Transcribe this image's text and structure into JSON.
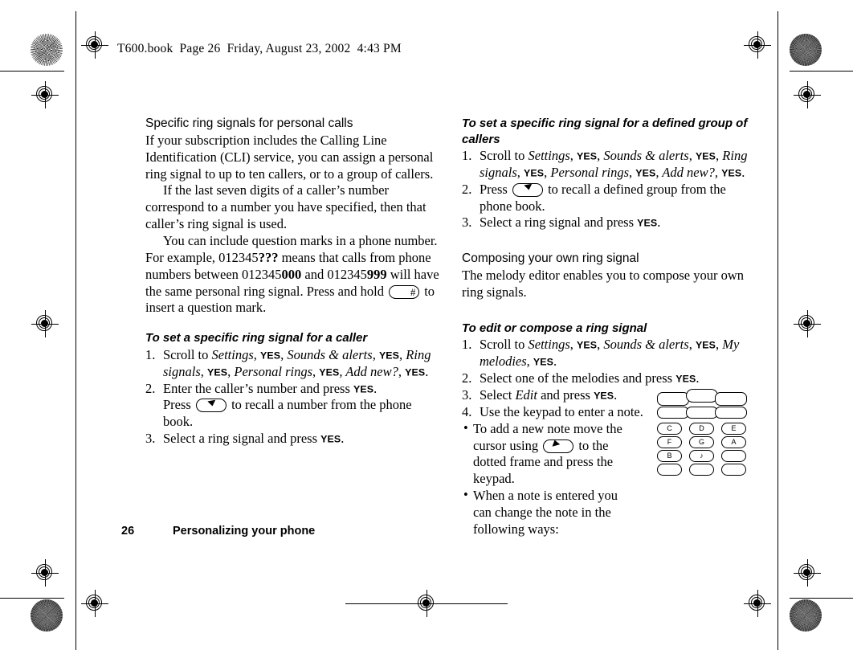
{
  "header": {
    "text": "T600.book  Page 26  Friday, August 23, 2002  4:43 PM"
  },
  "footer": {
    "page_number": "26",
    "section_title": "Personalizing your phone"
  },
  "keys": {
    "hash_label": "#",
    "yes_label": "YES",
    "down_key_name": "down-arrow-key",
    "up_key_name": "up-arrow-key"
  },
  "left_column": {
    "heading": "Specific ring signals for personal calls",
    "paragraph_1": "If your subscription includes the Calling Line Identification (CLI) service, you can assign a personal ring signal to up to ten callers, or to a group of callers.",
    "paragraph_2": "If the last seven digits of a caller’s number correspond to a number you have specified, then that caller’s ring signal is used.",
    "paragraph_3_a": "You can include question marks in a phone number. For example, 012345",
    "paragraph_3_b": "???",
    "paragraph_3_c": " means that calls from phone numbers between 012345",
    "paragraph_3_d": "000",
    "paragraph_3_e": " and 012345",
    "paragraph_3_f": "999",
    "paragraph_3_g": " will have the same personal ring signal. Press and hold ",
    "paragraph_3_h": " to insert a question mark.",
    "subheading": "To set a specific ring signal for a caller",
    "steps": [
      {
        "num": "1.",
        "parts": [
          {
            "t": "Scroll to ",
            "s": "plain"
          },
          {
            "t": "Settings",
            "s": "italic"
          },
          {
            "t": ", ",
            "s": "plain"
          },
          {
            "t": "YES",
            "s": "yes"
          },
          {
            "t": ", ",
            "s": "plain"
          },
          {
            "t": "Sounds & alerts",
            "s": "italic"
          },
          {
            "t": ", ",
            "s": "plain"
          },
          {
            "t": "YES",
            "s": "yes"
          },
          {
            "t": ", ",
            "s": "plain"
          },
          {
            "t": "Ring signals",
            "s": "italic"
          },
          {
            "t": ", ",
            "s": "plain"
          },
          {
            "t": "YES",
            "s": "yes"
          },
          {
            "t": ",  ",
            "s": "plain"
          },
          {
            "t": "Personal rings",
            "s": "italic"
          },
          {
            "t": ", ",
            "s": "plain"
          },
          {
            "t": "YES",
            "s": "yes"
          },
          {
            "t": ", ",
            "s": "italic"
          },
          {
            "t": "Add new?,",
            "s": "italic"
          },
          {
            "t": " ",
            "s": "plain"
          },
          {
            "t": "YES",
            "s": "yes"
          },
          {
            "t": ".",
            "s": "plain"
          }
        ]
      },
      {
        "num": "2.",
        "parts": [
          {
            "t": "Enter the caller’s number and press ",
            "s": "plain"
          },
          {
            "t": "YES",
            "s": "yes"
          },
          {
            "t": ".",
            "s": "plain"
          },
          {
            "t": "BREAK",
            "s": "break"
          },
          {
            "t": "Press ",
            "s": "plain"
          },
          {
            "t": "",
            "s": "key-down"
          },
          {
            "t": " to recall a number from the phone book.",
            "s": "plain"
          }
        ]
      },
      {
        "num": "3.",
        "parts": [
          {
            "t": "Select a ring signal and press ",
            "s": "plain"
          },
          {
            "t": "YES",
            "s": "yes"
          },
          {
            "t": ".",
            "s": "plain"
          }
        ]
      }
    ]
  },
  "right_column": {
    "subheading_1": "To set a specific ring signal for a defined group of callers",
    "steps_1": [
      {
        "num": "1.",
        "parts": [
          {
            "t": "Scroll to ",
            "s": "plain"
          },
          {
            "t": "Settings",
            "s": "italic"
          },
          {
            "t": ", ",
            "s": "plain"
          },
          {
            "t": "YES",
            "s": "yes"
          },
          {
            "t": ", ",
            "s": "plain"
          },
          {
            "t": "Sounds & alerts",
            "s": "italic"
          },
          {
            "t": ", ",
            "s": "plain"
          },
          {
            "t": "YES",
            "s": "yes"
          },
          {
            "t": ", ",
            "s": "plain"
          },
          {
            "t": "Ring signals",
            "s": "italic"
          },
          {
            "t": ", ",
            "s": "plain"
          },
          {
            "t": "YES",
            "s": "yes"
          },
          {
            "t": ",  ",
            "s": "plain"
          },
          {
            "t": "Personal rings",
            "s": "italic"
          },
          {
            "t": ", ",
            "s": "plain"
          },
          {
            "t": "YES",
            "s": "yes"
          },
          {
            "t": ", ",
            "s": "italic"
          },
          {
            "t": "Add new?,",
            "s": "italic"
          },
          {
            "t": " ",
            "s": "plain"
          },
          {
            "t": "YES",
            "s": "yes"
          },
          {
            "t": ".",
            "s": "plain"
          }
        ]
      },
      {
        "num": "2.",
        "parts": [
          {
            "t": "Press ",
            "s": "plain"
          },
          {
            "t": "",
            "s": "key-down"
          },
          {
            "t": " to recall a defined group from the phone book.",
            "s": "plain"
          }
        ]
      },
      {
        "num": "3.",
        "parts": [
          {
            "t": "Select a ring signal and press ",
            "s": "plain"
          },
          {
            "t": "YES",
            "s": "yes"
          },
          {
            "t": ".",
            "s": "plain"
          }
        ]
      }
    ],
    "heading_2": "Composing your own ring signal",
    "paragraph_1": "The melody editor enables you to compose your own ring signals.",
    "subheading_2": "To edit or compose a ring signal",
    "steps_2": [
      {
        "num": "1.",
        "parts": [
          {
            "t": "Scroll to ",
            "s": "plain"
          },
          {
            "t": "Settings",
            "s": "italic"
          },
          {
            "t": ", ",
            "s": "plain"
          },
          {
            "t": "YES",
            "s": "yes"
          },
          {
            "t": ", ",
            "s": "plain"
          },
          {
            "t": "Sounds & alerts",
            "s": "italic"
          },
          {
            "t": ", ",
            "s": "plain"
          },
          {
            "t": "YES",
            "s": "yes"
          },
          {
            "t": ",  ",
            "s": "plain"
          },
          {
            "t": "My melodies",
            "s": "italic"
          },
          {
            "t": ", ",
            "s": "plain"
          },
          {
            "t": "YES",
            "s": "yes"
          },
          {
            "t": ".",
            "s": "plain"
          }
        ]
      },
      {
        "num": "2.",
        "parts": [
          {
            "t": "Select one of the melodies and press ",
            "s": "plain"
          },
          {
            "t": "YES",
            "s": "yes"
          },
          {
            "t": ".",
            "s": "plain"
          }
        ]
      },
      {
        "num": "3.",
        "parts": [
          {
            "t": "Select ",
            "s": "plain"
          },
          {
            "t": "Edit",
            "s": "italic"
          },
          {
            "t": " and press ",
            "s": "plain"
          },
          {
            "t": "YES",
            "s": "yes"
          },
          {
            "t": ".",
            "s": "plain"
          }
        ]
      },
      {
        "num": "4.",
        "parts": [
          {
            "t": "Use the keypad to enter a note.",
            "s": "plain"
          }
        ]
      }
    ],
    "bullets": [
      {
        "bullet": "•",
        "parts": [
          {
            "t": "To add a new note move the cursor using ",
            "s": "plain"
          },
          {
            "t": "",
            "s": "key-up"
          },
          {
            "t": " to the dotted frame and press the keypad.",
            "s": "plain"
          }
        ]
      },
      {
        "bullet": "•",
        "parts": [
          {
            "t": "When a note is entered you can change the note in the following ways:",
            "s": "plain"
          }
        ]
      }
    ]
  },
  "keypad_illustration": {
    "name": "phone-keypad-diagram",
    "note_keys": [
      [
        "C",
        "D",
        "E"
      ],
      [
        "F",
        "G",
        "A"
      ],
      [
        "B",
        "♪",
        ""
      ],
      [
        "",
        "",
        ""
      ]
    ]
  }
}
